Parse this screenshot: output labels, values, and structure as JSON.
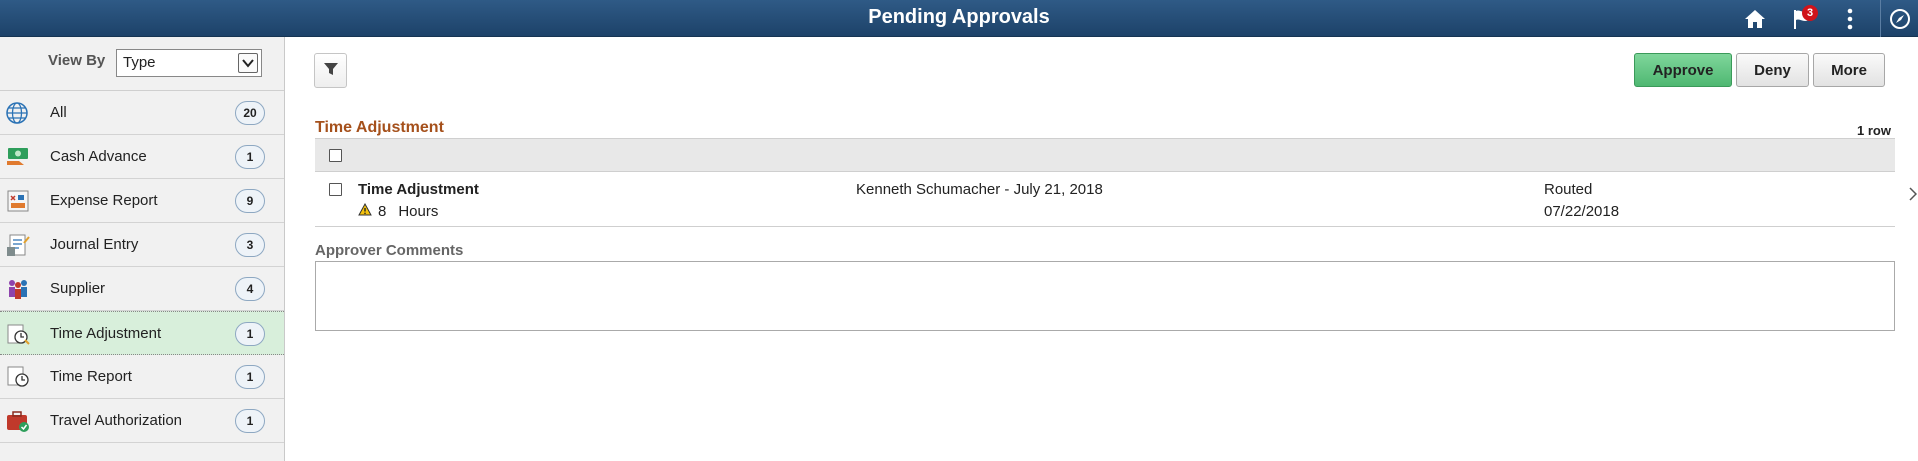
{
  "header": {
    "title": "Pending Approvals",
    "notification_count": "3"
  },
  "sidebar": {
    "view_by_label": "View By",
    "view_by_value": "Type",
    "items": [
      {
        "label": "All",
        "count": "20",
        "icon": "globe-icon"
      },
      {
        "label": "Cash Advance",
        "count": "1",
        "icon": "cash-advance-icon"
      },
      {
        "label": "Expense Report",
        "count": "9",
        "icon": "expense-report-icon"
      },
      {
        "label": "Journal Entry",
        "count": "3",
        "icon": "journal-entry-icon"
      },
      {
        "label": "Supplier",
        "count": "4",
        "icon": "supplier-icon"
      },
      {
        "label": "Time Adjustment",
        "count": "1",
        "icon": "time-adjustment-icon",
        "selected": true
      },
      {
        "label": "Time Report",
        "count": "1",
        "icon": "time-report-icon"
      },
      {
        "label": "Travel Authorization",
        "count": "1",
        "icon": "travel-authorization-icon"
      }
    ]
  },
  "toolbar": {
    "approve_label": "Approve",
    "deny_label": "Deny",
    "more_label": "More"
  },
  "section": {
    "title": "Time Adjustment",
    "row_count": "1 row",
    "rows": [
      {
        "title": "Time Adjustment",
        "quantity": "8",
        "unit": "Hours",
        "person_date": "Kenneth Schumacher - July 21, 2018",
        "status": "Routed",
        "date": "07/22/2018"
      }
    ]
  },
  "comments": {
    "label": "Approver Comments",
    "value": ""
  },
  "colors": {
    "header": "#1d4269",
    "approve": "#4fb872",
    "selected_row": "#d8efdb",
    "section_title": "#a5501b"
  }
}
